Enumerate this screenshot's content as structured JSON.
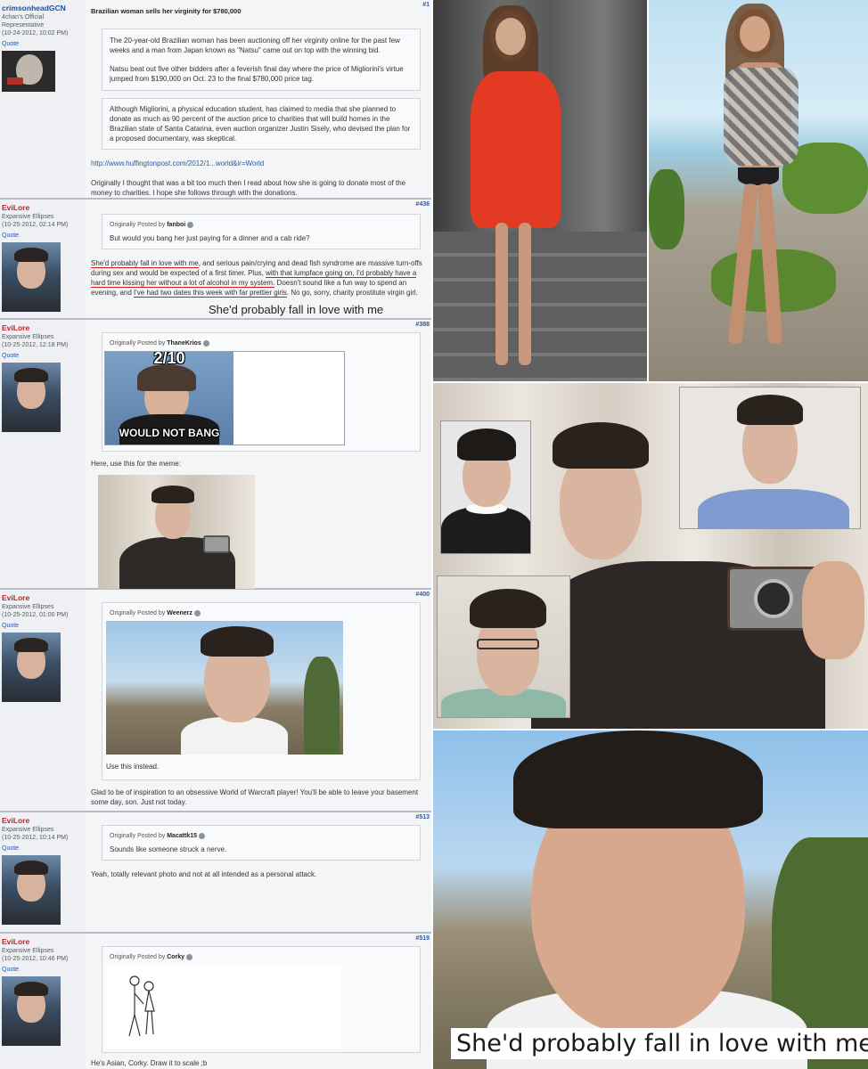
{
  "posts": [
    {
      "user": "crimsonheadGCN",
      "user_title": "4chan's Official Representative",
      "date": "(10-24-2012, 10:02 PM)",
      "quote_link": "Quote",
      "number": "#1",
      "thread_title": "Brazilian woman sells her virginity for $780,000",
      "quote_p1": "The 20-year-old Brazilian woman has been auctioning off her virginity online for the past few weeks and a man from Japan known as \"Natsu\" came out on top with the winning bid.",
      "quote_p2": "Natsu beat out five other bidders after a feverish final day where the price of Migliorini's virtue jumped from $190,000 on Oct. 23 to the final $780,000 price tag.",
      "quote_p3": "Although Migliorini, a physical education student, has claimed to media that she planned to donate as much as 90 percent of the auction price to charities that will build homes in the Brazilian state of Santa Catarina, even auction organizer Justin Sisely, who devised the plan for a proposed documentary, was skeptical.",
      "url": "http://www.huffingtonpost.com/2012/1...world&ir=World",
      "body": "Originally I thought that was a bit too much then I read about how she is going to donate most of the money to charities. I hope she follows through with the donations."
    },
    {
      "user": "EviLore",
      "user_title": "Expansive Ellipses",
      "date": "(10-25-2012, 02:14 PM)",
      "quote_link": "Quote",
      "number": "#436",
      "quoted_by": "Originally Posted by",
      "quoted_user": "fanboi",
      "quoted_text": "But would you bang her just paying for a dinner and a cab ride?",
      "body_u1": "She'd probably fall in love with me",
      "body_t1": ", and serious pain/crying and dead fish syndrome are massive turn-offs during sex and would be expected of a first timer. Plus, ",
      "body_u2": "with that lumpface going on, I'd probably have a hard time kissing her without a lot of alcohol in my system.",
      "body_t2": " Doesn't sound like a fun way to spend an evening, and ",
      "body_u3": "I've had two dates this week with far prettier girls",
      "body_t3": ". No go, sorry, charity prostitute virgin girl.",
      "caption": "She'd probably fall in love with me"
    },
    {
      "user": "EviLore",
      "user_title": "Expansive Ellipses",
      "date": "(10-25-2012, 12:18 PM)",
      "quote_link": "Quote",
      "number": "#388",
      "quoted_by": "Originally Posted by",
      "quoted_user": "ThaneKrios",
      "meme_top": "2/10",
      "meme_bottom": "WOULD NOT BANG",
      "body": "Here, use this for the meme:"
    },
    {
      "user": "EviLore",
      "user_title": "Expansive Ellipses",
      "date": "(10-25-2012, 01:00 PM)",
      "quote_link": "Quote",
      "number": "#400",
      "quoted_by": "Originally Posted by",
      "quoted_user": "Weenerz",
      "quoted_text": "Use this instead.",
      "body": "Glad to be of inspiration to an obsessive World of Warcraft player! You'll be able to leave your basement some day, son. Just not today."
    },
    {
      "user": "EviLore",
      "user_title": "Expansive Ellipses",
      "date": "(10-25-2012, 10:14 PM)",
      "quote_link": "Quote",
      "number": "#513",
      "quoted_by": "Originally Posted by",
      "quoted_user": "Macattk15",
      "quoted_text": "Sounds like someone struck a nerve.",
      "body": "Yeah, totally relevant photo and not at all intended as a personal attack."
    },
    {
      "user": "EviLore",
      "user_title": "Expansive Ellipses",
      "date": "(10-25-2012, 10:46 PM)",
      "quote_link": "Quote",
      "number": "#519",
      "quoted_by": "Originally Posted by",
      "quoted_user": "Corky",
      "body": "He's Asian, Corky. Draw it to scale ;b"
    }
  ],
  "bottom_caption": "She'd probably fall in love with me",
  "colors": {
    "username_blue": "#1e4fa1",
    "username_red": "#c81d1d",
    "underline_red": "#d11b1b",
    "post_bg": "#f4f5f7"
  }
}
